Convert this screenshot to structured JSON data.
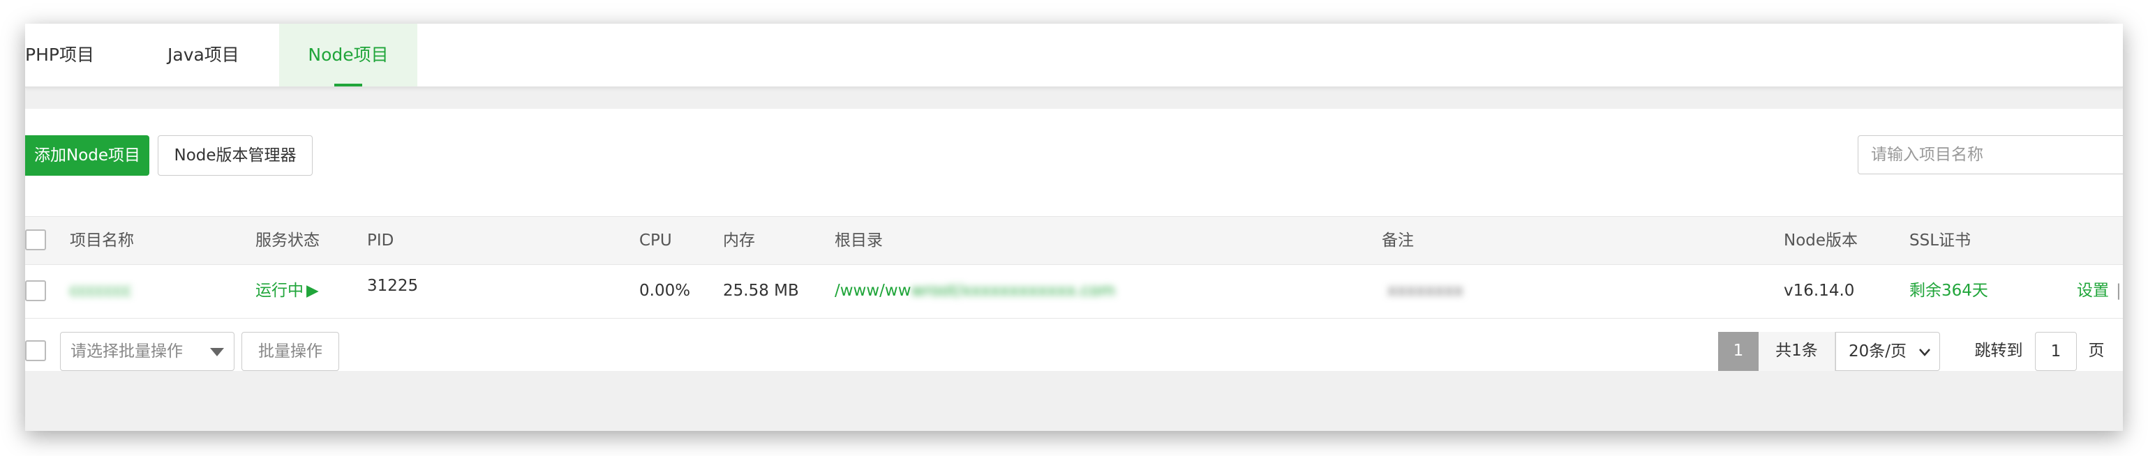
{
  "tabs": [
    "PHP项目",
    "Java项目",
    "Node项目"
  ],
  "toolbar": {
    "add_label": "添加Node项目",
    "version_manager_label": "Node版本管理器",
    "search_placeholder": "请输入项目名称"
  },
  "table": {
    "headers": {
      "name": "项目名称",
      "status": "服务状态",
      "pid": "PID",
      "cpu": "CPU",
      "memory": "内存",
      "root": "根目录",
      "remark": "备注",
      "node_version": "Node版本",
      "ssl": "SSL证书"
    },
    "rows": [
      {
        "name": "ccccccc",
        "status": "运行中",
        "status_icon": "play-icon ▶",
        "pid": "31225",
        "cpu": "0.00%",
        "memory": "25.58 MB",
        "root_visible": "/www/ww",
        "root_blurred": "wroot/xxxxxxxxxxxx.com",
        "remark": "xxxxxxxx",
        "node_version": "v16.14.0",
        "ssl": "剩余364天",
        "action": "设置"
      }
    ]
  },
  "footer": {
    "batch_select_placeholder": "请选择批量操作",
    "batch_button": "批量操作",
    "current_page": "1",
    "total": "共1条",
    "page_size": "20条/页",
    "jump_label": "跳转到",
    "jump_value": "1",
    "page_unit": "页"
  },
  "colors": {
    "accent": "#20a53a",
    "header_bg": "#f5f5f5",
    "page_bg": "#f0f0f0"
  }
}
